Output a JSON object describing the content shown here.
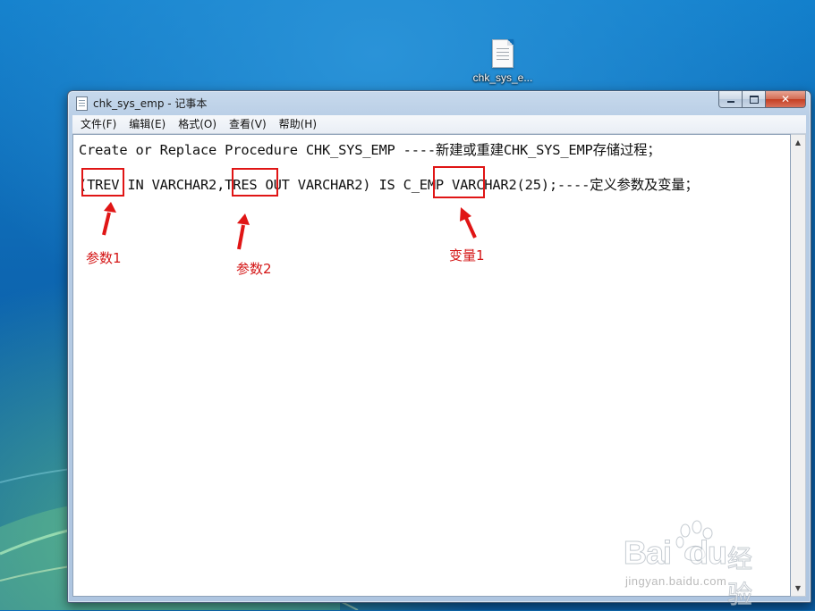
{
  "desktop": {
    "file_icon": {
      "icon": "text-file-icon",
      "label": "chk_sys_e..."
    }
  },
  "window": {
    "title": "chk_sys_emp - 记事本",
    "title_icon": "notepad-icon",
    "controls": {
      "minimize": "minimize-icon",
      "maximize": "maximize-icon",
      "close_label": "✕"
    }
  },
  "menu": {
    "items": [
      {
        "label": "文件(F)"
      },
      {
        "label": "编辑(E)"
      },
      {
        "label": "格式(O)"
      },
      {
        "label": "查看(V)"
      },
      {
        "label": "帮助(H)"
      }
    ]
  },
  "editor": {
    "lines": [
      "Create or Replace Procedure CHK_SYS_EMP ----新建或重建CHK_SYS_EMP存储过程；",
      "(TREV IN VARCHAR2,TRES OUT VARCHAR2) IS C_EMP VARCHAR2(25);----定义参数及变量；"
    ]
  },
  "annotations": {
    "color": "#e01515",
    "labels": [
      "参数1",
      "参数2",
      "变量1"
    ]
  },
  "watermark": {
    "logo": "Bai",
    "logo_tail": "du",
    "chinese": "经验",
    "url": "jingyan.baidu.com"
  }
}
